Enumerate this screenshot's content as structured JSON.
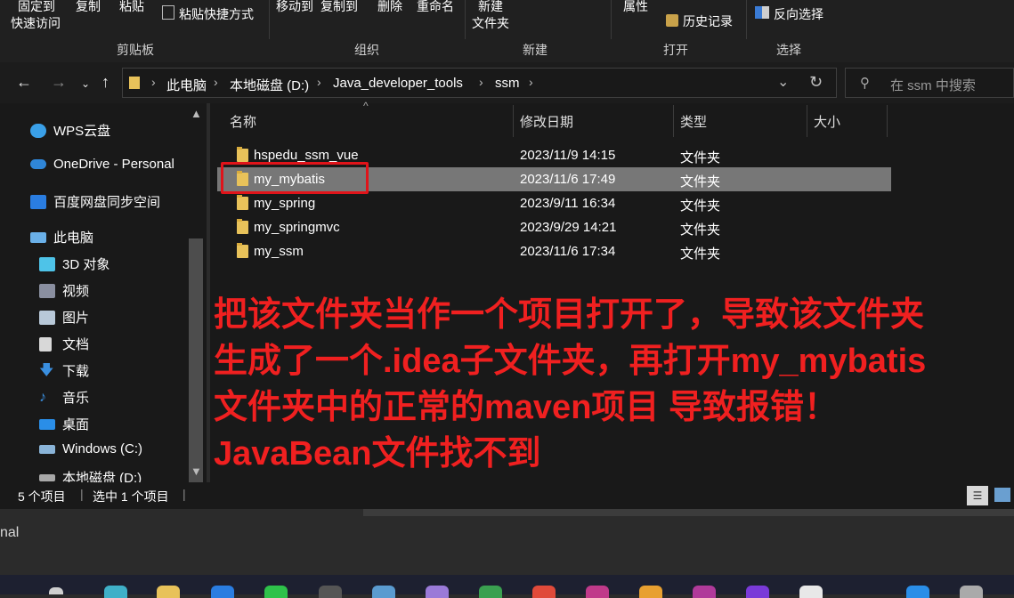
{
  "ribbon": {
    "clipboard": {
      "pin_label_1": "固定到",
      "pin_label_2": "快速访问",
      "copy": "复制",
      "paste": "粘贴",
      "paste_shortcut": "粘贴快捷方式",
      "group": "剪贴板"
    },
    "organize": {
      "move_to": "移动到",
      "copy_to": "复制到",
      "delete": "删除",
      "rename": "重命名",
      "group": "组织"
    },
    "new": {
      "new_label_1": "新建",
      "new_label_2": "文件夹",
      "group": "新建"
    },
    "open": {
      "properties": "属性",
      "history": "历史记录",
      "group": "打开"
    },
    "select": {
      "invert": "反向选择",
      "group": "选择"
    }
  },
  "address": {
    "breadcrumbs": [
      "此电脑",
      "本地磁盘 (D:)",
      "Java_developer_tools",
      "ssm"
    ],
    "search_placeholder": "在 ssm 中搜索"
  },
  "nav": {
    "items": [
      {
        "label": "WPS云盘",
        "icon": "cloud-icon"
      },
      {
        "label": "OneDrive - Personal",
        "icon": "onedrive-icon"
      },
      {
        "label": "百度网盘同步空间",
        "icon": "baidu-cloud-icon"
      },
      {
        "label": "此电脑",
        "icon": "computer-icon"
      },
      {
        "label": "3D 对象",
        "icon": "cube-icon"
      },
      {
        "label": "视频",
        "icon": "video-icon"
      },
      {
        "label": "图片",
        "icon": "picture-icon"
      },
      {
        "label": "文档",
        "icon": "document-icon"
      },
      {
        "label": "下载",
        "icon": "download-icon"
      },
      {
        "label": "音乐",
        "icon": "music-icon"
      },
      {
        "label": "桌面",
        "icon": "desktop-icon"
      },
      {
        "label": "Windows (C:)",
        "icon": "drive-icon"
      },
      {
        "label": "本地磁盘 (D:)",
        "icon": "drive-icon"
      }
    ]
  },
  "columns": {
    "name": "名称",
    "modified": "修改日期",
    "type": "类型",
    "size": "大小"
  },
  "files": [
    {
      "name": "hspedu_ssm_vue",
      "modified": "2023/11/9 14:15",
      "type": "文件夹",
      "selected": false
    },
    {
      "name": "my_mybatis",
      "modified": "2023/11/6 17:49",
      "type": "文件夹",
      "selected": true
    },
    {
      "name": "my_spring",
      "modified": "2023/9/11 16:34",
      "type": "文件夹",
      "selected": false
    },
    {
      "name": "my_springmvc",
      "modified": "2023/9/29 14:21",
      "type": "文件夹",
      "selected": false
    },
    {
      "name": "my_ssm",
      "modified": "2023/11/6 17:34",
      "type": "文件夹",
      "selected": false
    }
  ],
  "annotation": {
    "line1": "把该文件夹当作一个项目打开了，导致该文件夹",
    "line2": "生成了一个.idea子文件夹，再打开my_mybatis",
    "line3": "文件夹中的正常的maven项目 导致报错！",
    "line4": "JavaBean文件找不到",
    "color": "#f02020"
  },
  "status": {
    "item_count": "5 个项目",
    "selected": "选中 1 个项目"
  },
  "background_text": "nal"
}
